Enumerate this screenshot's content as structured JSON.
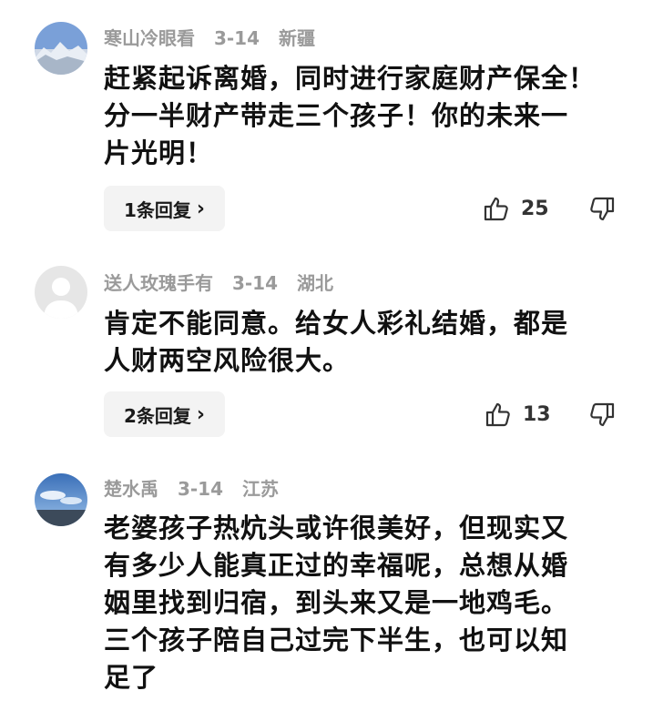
{
  "comments": [
    {
      "username": "寒山冷眼看",
      "date": "3-14",
      "location": "新疆",
      "avatar_icon": "mountain-avatar-icon",
      "lines": [
        "赶紧起诉离婚，同时进行家庭财产保全！",
        "分一半财产带走三个孩子！你的未来一",
        "片光明！"
      ],
      "reply_label": "1条回复",
      "likes": "25"
    },
    {
      "username": "送人玫瑰手有",
      "date": "3-14",
      "location": "湖北",
      "avatar_icon": "default-person-avatar-icon",
      "lines": [
        "肯定不能同意。给女人彩礼结婚，都是",
        "人财两空风险很大。"
      ],
      "reply_label": "2条回复",
      "likes": "13"
    },
    {
      "username": "楚水禹",
      "date": "3-14",
      "location": "江苏",
      "avatar_icon": "sky-avatar-icon",
      "lines": [
        "老婆孩子热炕头或许很美好，但现实又",
        "有多少人能真正过的幸福呢，总想从婚",
        "姻里找到归宿，到头来又是一地鸡毛。",
        "三个孩子陪自己过完下半生，也可以知",
        "足了"
      ]
    }
  ],
  "icons": {
    "like": "thumbs-up-icon",
    "dislike": "thumbs-down-icon",
    "chevron": "chevron-right-icon"
  },
  "colors": {
    "meta_text": "#9a9a9a",
    "body_text": "#111111",
    "reply_bg": "#f3f3f3"
  }
}
